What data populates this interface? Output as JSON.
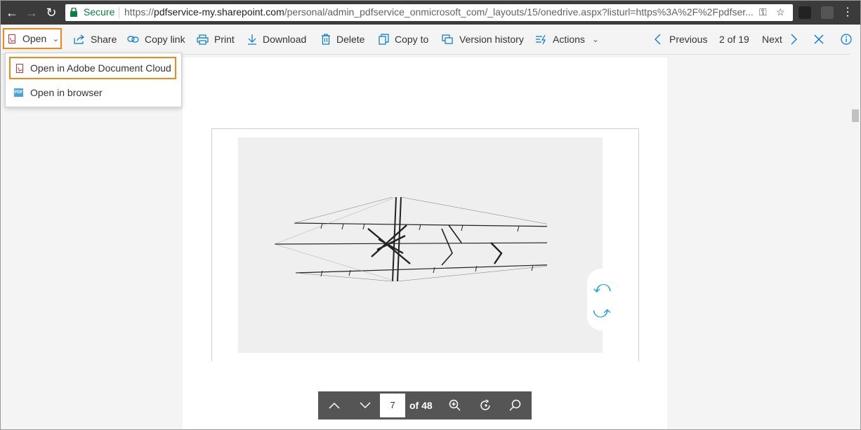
{
  "browser": {
    "secure_label": "Secure",
    "url_scheme": "https://",
    "url_host": "pdfservice-my.sharepoint.com",
    "url_path": "/personal/admin_pdfservice_onmicrosoft_com/_layouts/15/onedrive.aspx?listurl=https%3A%2F%2Fpdfser..."
  },
  "toolbar": {
    "open": "Open",
    "share": "Share",
    "copy_link": "Copy link",
    "print": "Print",
    "download": "Download",
    "delete": "Delete",
    "copy_to": "Copy to",
    "version_history": "Version history",
    "actions": "Actions",
    "previous": "Previous",
    "position": "2 of 19",
    "next": "Next"
  },
  "open_menu": {
    "items": [
      {
        "label": "Open in Adobe Document Cloud"
      },
      {
        "label": "Open in browser"
      }
    ]
  },
  "page_nav": {
    "current_page": "7",
    "total": "of 48"
  },
  "colors": {
    "accent": "#0078d4",
    "highlight": "#f0891a",
    "chrome_bar": "#3b3b3b",
    "secure_green": "#0b8043"
  }
}
